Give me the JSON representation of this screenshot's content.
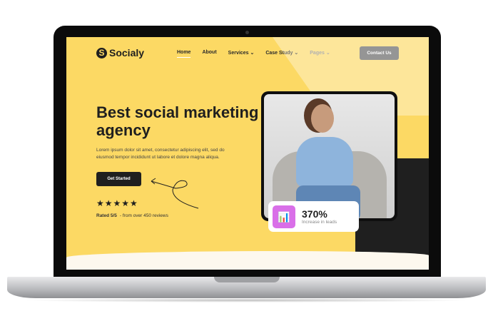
{
  "brand": {
    "name": "Socialy",
    "logo_letter": "S"
  },
  "nav": {
    "items": [
      {
        "label": "Home",
        "active": true
      },
      {
        "label": "About"
      },
      {
        "label": "Services",
        "dropdown": true
      },
      {
        "label": "Case Study",
        "dropdown": true
      },
      {
        "label": "Pages",
        "dropdown": true
      }
    ],
    "contact_label": "Contact Us"
  },
  "hero": {
    "title": "Best social marketing agency",
    "lead": "Lorem ipsum dolor sit amet, consectetur adipiscing elit, sed do eiusmod tempor incididunt ut labore et dolore magna aliqua.",
    "cta_label": "Get Started",
    "stars": "★★★★★",
    "rating": 5,
    "rated_label": "Rated 5/5",
    "reviews_label": "- from over 450 reviews"
  },
  "stat": {
    "value": "370%",
    "label": "Increase in leads",
    "icon": "bar-chart-growth-icon",
    "icon_color": "#d96fe8"
  },
  "colors": {
    "accent": "#fcd964",
    "dark": "#1f1f1f"
  }
}
